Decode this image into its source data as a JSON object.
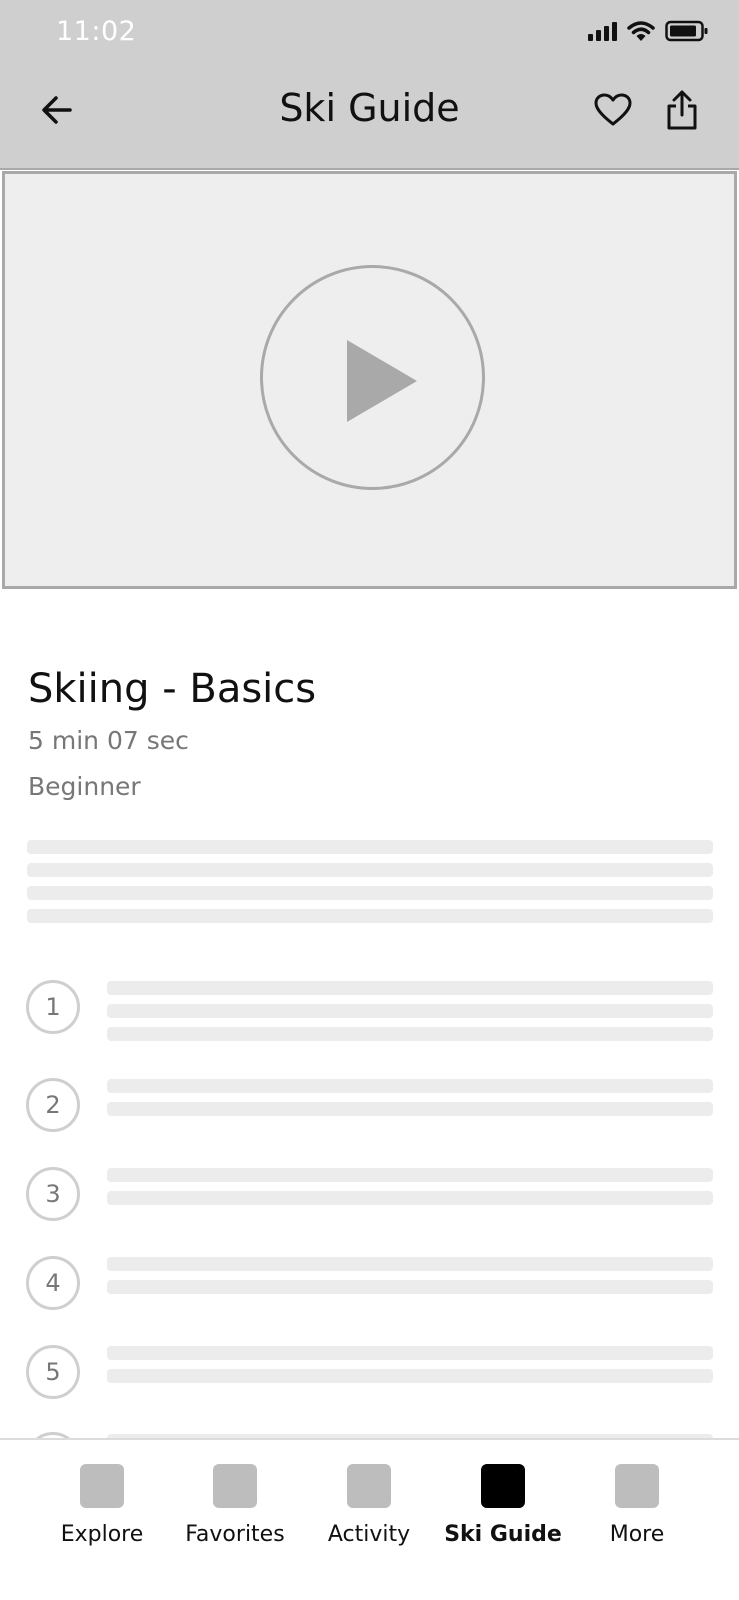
{
  "status_bar": {
    "time": "11:02"
  },
  "header": {
    "title": "Ski Guide"
  },
  "video": {
    "play_icon": "play-icon"
  },
  "lesson": {
    "title": "Skiing - Basics",
    "duration": "5 min 07 sec",
    "level": "Beginner"
  },
  "steps": [
    {
      "number": "1"
    },
    {
      "number": "2"
    },
    {
      "number": "3"
    },
    {
      "number": "4"
    },
    {
      "number": "5"
    }
  ],
  "bottom_nav": {
    "items": [
      {
        "label": "Explore"
      },
      {
        "label": "Favorites"
      },
      {
        "label": "Activity"
      },
      {
        "label": "Ski Guide"
      },
      {
        "label": "More"
      }
    ]
  },
  "colors": {
    "header_bg": "#cfcfcf",
    "video_bg": "#eeeeee",
    "placeholder": "#ececec",
    "active_nav": "#000000",
    "inactive_nav": "#bdbdbd"
  }
}
